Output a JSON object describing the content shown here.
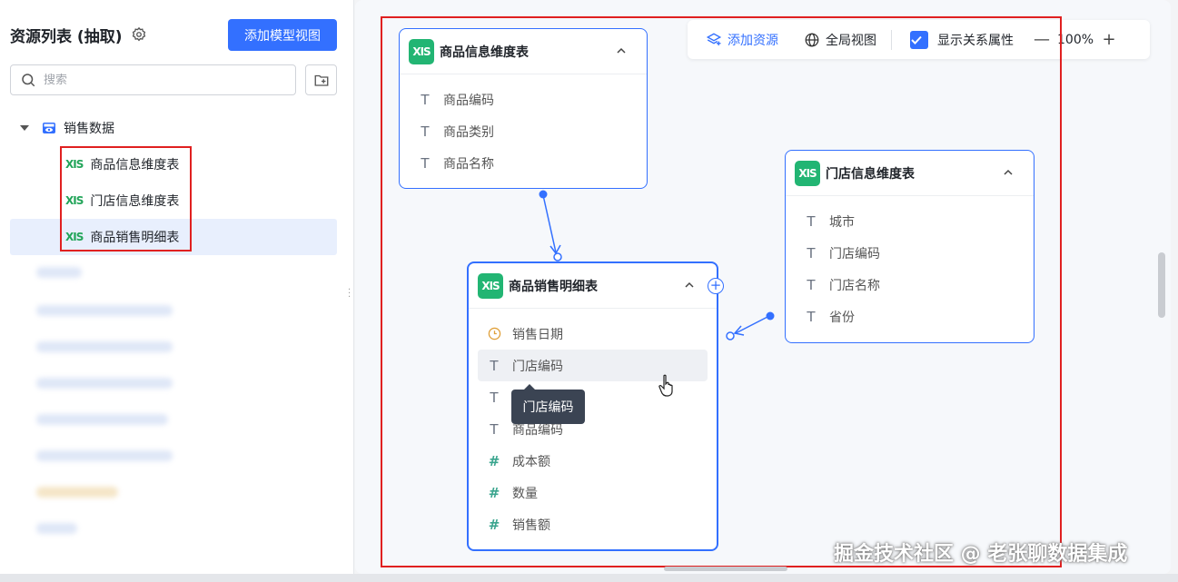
{
  "sidebar": {
    "title": "资源列表 (抽取)",
    "add_view_button": "添加模型视图",
    "search_placeholder": "搜索",
    "tree": {
      "root_label": "销售数据",
      "items": [
        {
          "icon": "xls",
          "label": "商品信息维度表"
        },
        {
          "icon": "xls",
          "label": "门店信息维度表"
        },
        {
          "icon": "xls",
          "label": "商品销售明细表",
          "selected": true
        }
      ]
    }
  },
  "toolbar": {
    "add_resource": "添加资源",
    "global_view": "全局视图",
    "show_relation_attrs": "显示关系属性",
    "show_relation_checked": true,
    "zoom": "100%"
  },
  "cards": {
    "product_dim": {
      "badge": "XIS",
      "title": "商品信息维度表",
      "fields": [
        {
          "type": "text",
          "name": "商品编码"
        },
        {
          "type": "text",
          "name": "商品类别"
        },
        {
          "type": "text",
          "name": "商品名称"
        }
      ]
    },
    "store_dim": {
      "badge": "XIS",
      "title": "门店信息维度表",
      "fields": [
        {
          "type": "text",
          "name": "城市"
        },
        {
          "type": "text",
          "name": "门店编码"
        },
        {
          "type": "text",
          "name": "门店名称"
        },
        {
          "type": "text",
          "name": "省份"
        }
      ]
    },
    "sales_detail": {
      "badge": "XIS",
      "title": "商品销售明细表",
      "fields": [
        {
          "type": "date",
          "name": "销售日期"
        },
        {
          "type": "text",
          "name": "门店编码"
        },
        {
          "type": "text",
          "name": ""
        },
        {
          "type": "text",
          "name": "商品编码"
        },
        {
          "type": "number",
          "name": "成本额"
        },
        {
          "type": "number",
          "name": "数量"
        },
        {
          "type": "number",
          "name": "销售额"
        }
      ]
    }
  },
  "tooltip": "门店编码",
  "watermark": "掘金技术社区 @ 老张聊数据集成",
  "colors": {
    "primary": "#3370ff",
    "xls_green": "#22b573",
    "highlight_red": "#e02020"
  }
}
